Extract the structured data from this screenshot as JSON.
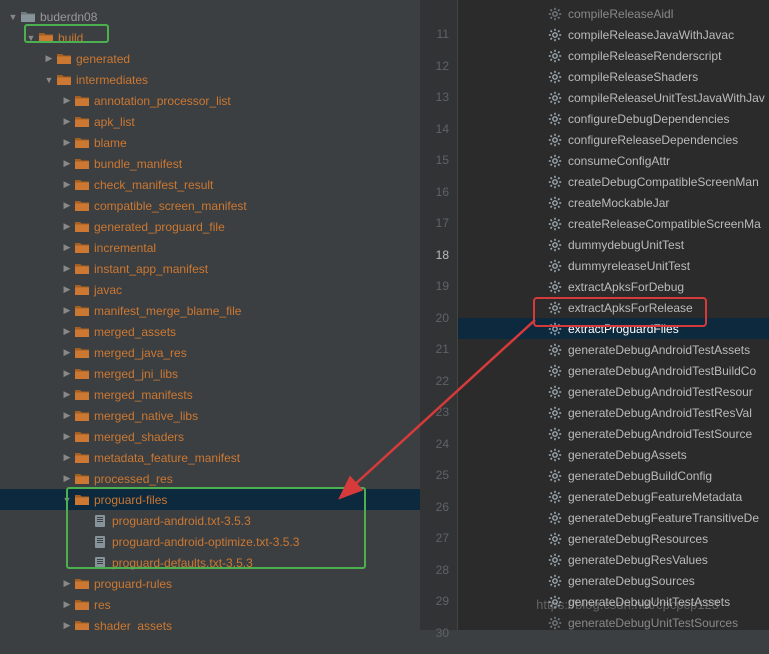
{
  "tree": [
    {
      "indent": 0,
      "arrow": "down",
      "icon": "folder-gray",
      "label": "buderdn08",
      "color": "gray"
    },
    {
      "indent": 1,
      "arrow": "down",
      "icon": "folder",
      "label": "build",
      "color": "orange"
    },
    {
      "indent": 2,
      "arrow": "right",
      "icon": "folder",
      "label": "generated",
      "color": "orange"
    },
    {
      "indent": 2,
      "arrow": "down",
      "icon": "folder",
      "label": "intermediates",
      "color": "orange"
    },
    {
      "indent": 3,
      "arrow": "right",
      "icon": "folder",
      "label": "annotation_processor_list",
      "color": "orange"
    },
    {
      "indent": 3,
      "arrow": "right",
      "icon": "folder",
      "label": "apk_list",
      "color": "orange"
    },
    {
      "indent": 3,
      "arrow": "right",
      "icon": "folder",
      "label": "blame",
      "color": "orange"
    },
    {
      "indent": 3,
      "arrow": "right",
      "icon": "folder",
      "label": "bundle_manifest",
      "color": "orange"
    },
    {
      "indent": 3,
      "arrow": "right",
      "icon": "folder",
      "label": "check_manifest_result",
      "color": "orange"
    },
    {
      "indent": 3,
      "arrow": "right",
      "icon": "folder",
      "label": "compatible_screen_manifest",
      "color": "orange"
    },
    {
      "indent": 3,
      "arrow": "right",
      "icon": "folder",
      "label": "generated_proguard_file",
      "color": "orange"
    },
    {
      "indent": 3,
      "arrow": "right",
      "icon": "folder",
      "label": "incremental",
      "color": "orange"
    },
    {
      "indent": 3,
      "arrow": "right",
      "icon": "folder",
      "label": "instant_app_manifest",
      "color": "orange"
    },
    {
      "indent": 3,
      "arrow": "right",
      "icon": "folder",
      "label": "javac",
      "color": "orange"
    },
    {
      "indent": 3,
      "arrow": "right",
      "icon": "folder",
      "label": "manifest_merge_blame_file",
      "color": "orange"
    },
    {
      "indent": 3,
      "arrow": "right",
      "icon": "folder",
      "label": "merged_assets",
      "color": "orange"
    },
    {
      "indent": 3,
      "arrow": "right",
      "icon": "folder",
      "label": "merged_java_res",
      "color": "orange"
    },
    {
      "indent": 3,
      "arrow": "right",
      "icon": "folder",
      "label": "merged_jni_libs",
      "color": "orange"
    },
    {
      "indent": 3,
      "arrow": "right",
      "icon": "folder",
      "label": "merged_manifests",
      "color": "orange"
    },
    {
      "indent": 3,
      "arrow": "right",
      "icon": "folder",
      "label": "merged_native_libs",
      "color": "orange"
    },
    {
      "indent": 3,
      "arrow": "right",
      "icon": "folder",
      "label": "merged_shaders",
      "color": "orange"
    },
    {
      "indent": 3,
      "arrow": "right",
      "icon": "folder",
      "label": "metadata_feature_manifest",
      "color": "orange"
    },
    {
      "indent": 3,
      "arrow": "right",
      "icon": "folder",
      "label": "processed_res",
      "color": "orange",
      "selected": false
    },
    {
      "indent": 3,
      "arrow": "down",
      "icon": "folder",
      "label": "proguard-files",
      "color": "orange",
      "selected": true
    },
    {
      "indent": 4,
      "arrow": "none",
      "icon": "file",
      "label": "proguard-android.txt-3.5.3",
      "color": "orange"
    },
    {
      "indent": 4,
      "arrow": "none",
      "icon": "file",
      "label": "proguard-android-optimize.txt-3.5.3",
      "color": "orange"
    },
    {
      "indent": 4,
      "arrow": "none",
      "icon": "file",
      "label": "proguard-defaults.txt-3.5.3",
      "color": "orange"
    },
    {
      "indent": 3,
      "arrow": "right",
      "icon": "folder",
      "label": "proguard-rules",
      "color": "orange"
    },
    {
      "indent": 3,
      "arrow": "right",
      "icon": "folder",
      "label": "res",
      "color": "orange"
    },
    {
      "indent": 3,
      "arrow": "right",
      "icon": "folder",
      "label": "shader_assets",
      "color": "orange"
    }
  ],
  "lineNumbers": {
    "start": 11,
    "end": 30,
    "active": 18
  },
  "tasks": [
    {
      "label": "compileReleaseAidl",
      "cut": true
    },
    {
      "label": "compileReleaseJavaWithJavac"
    },
    {
      "label": "compileReleaseRenderscript"
    },
    {
      "label": "compileReleaseShaders"
    },
    {
      "label": "compileReleaseUnitTestJavaWithJav"
    },
    {
      "label": "configureDebugDependencies"
    },
    {
      "label": "configureReleaseDependencies"
    },
    {
      "label": "consumeConfigAttr"
    },
    {
      "label": "createDebugCompatibleScreenMan"
    },
    {
      "label": "createMockableJar"
    },
    {
      "label": "createReleaseCompatibleScreenMa"
    },
    {
      "label": "dummydebugUnitTest"
    },
    {
      "label": "dummyreleaseUnitTest"
    },
    {
      "label": "extractApksForDebug"
    },
    {
      "label": "extractApksForRelease"
    },
    {
      "label": "extractProguardFiles",
      "selected": true
    },
    {
      "label": "generateDebugAndroidTestAssets"
    },
    {
      "label": "generateDebugAndroidTestBuildCo"
    },
    {
      "label": "generateDebugAndroidTestResour"
    },
    {
      "label": "generateDebugAndroidTestResVal"
    },
    {
      "label": "generateDebugAndroidTestSource"
    },
    {
      "label": "generateDebugAssets"
    },
    {
      "label": "generateDebugBuildConfig"
    },
    {
      "label": "generateDebugFeatureMetadata"
    },
    {
      "label": "generateDebugFeatureTransitiveDe"
    },
    {
      "label": "generateDebugResources"
    },
    {
      "label": "generateDebugResValues"
    },
    {
      "label": "generateDebugSources"
    },
    {
      "label": "generateDebugUnitTestAssets"
    },
    {
      "label": "generateDebugUnitTestSources",
      "cut": true
    }
  ],
  "watermark": "https://blog.csdn.net/cpcpcp123"
}
